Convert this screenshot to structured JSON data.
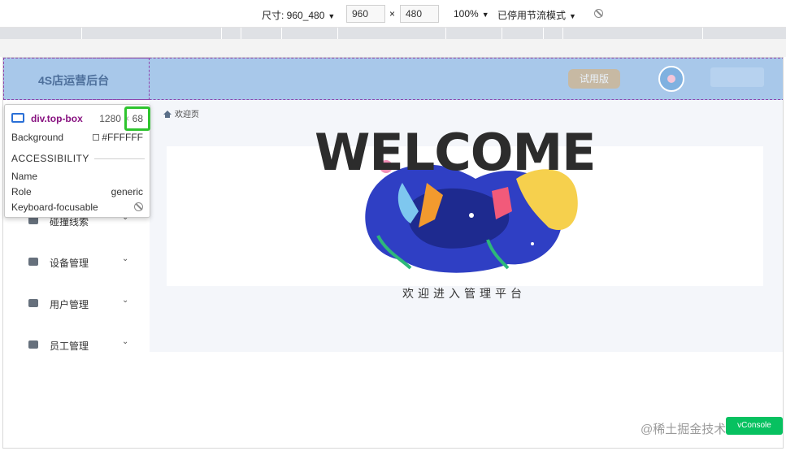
{
  "devtools": {
    "size_label": "尺寸: 960_480",
    "width": "960",
    "times": "×",
    "height": "480",
    "zoom": "100%",
    "throttle": "已停用节流模式"
  },
  "app": {
    "title": "4S店运营后台",
    "trial_badge": "试用版",
    "breadcrumb": "欢迎页",
    "welcome_title": "WELCOME",
    "welcome_subtitle": "欢迎进入管理平台",
    "menu": [
      {
        "label": "碰撞线索",
        "icon": "car-icon"
      },
      {
        "label": "设备管理",
        "icon": "device-icon"
      },
      {
        "label": "用户管理",
        "icon": "user-icon"
      },
      {
        "label": "员工管理",
        "icon": "staff-icon"
      }
    ]
  },
  "inspector": {
    "selector": "div.top-box",
    "width": "1280",
    "dims_sep": "×",
    "height": "68",
    "background_label": "Background",
    "background_value": "#FFFFFF",
    "section": "ACCESSIBILITY",
    "name_label": "Name",
    "role_label": "Role",
    "role_value": "generic",
    "focusable_label": "Keyboard-focusable"
  },
  "watermark": "@稀土掘金技术社区",
  "vconsole": "vConsole"
}
